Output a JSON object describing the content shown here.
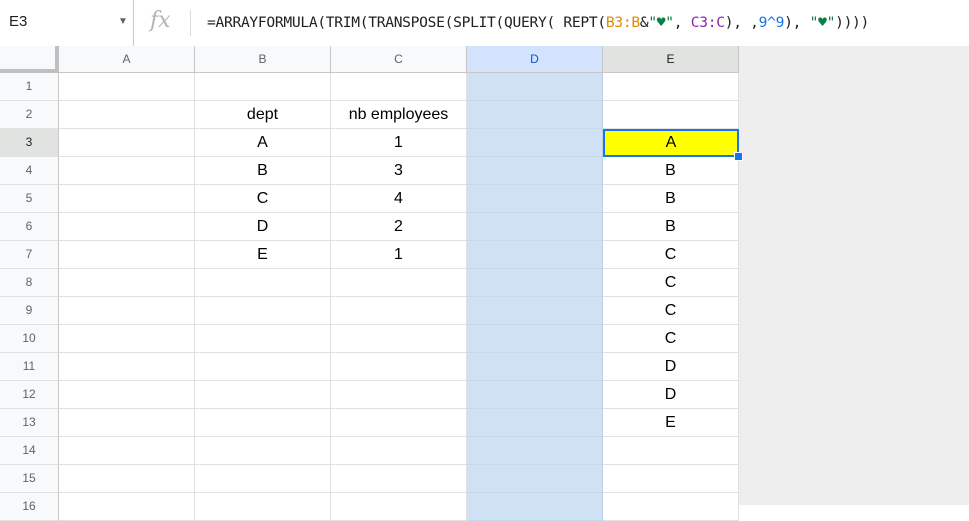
{
  "name_box": "E3",
  "formula": [
    {
      "text": "=ARRAYFORMULA(TRIM(TRANSPOSE(SPLIT(QUERY( REPT(",
      "kind": "plain"
    },
    {
      "text": "B3:B",
      "kind": "ref1"
    },
    {
      "text": "&",
      "kind": "plain"
    },
    {
      "text": "\"♥\"",
      "kind": "str"
    },
    {
      "text": ", ",
      "kind": "plain"
    },
    {
      "text": "C3:C",
      "kind": "ref2"
    },
    {
      "text": "), ,",
      "kind": "plain"
    },
    {
      "text": "9^9",
      "kind": "num"
    },
    {
      "text": "), ",
      "kind": "plain"
    },
    {
      "text": "\"♥\"",
      "kind": "str"
    },
    {
      "text": "))))",
      "kind": "plain"
    }
  ],
  "columns": [
    "A",
    "B",
    "C",
    "D",
    "E"
  ],
  "rows": [
    "1",
    "2",
    "3",
    "4",
    "5",
    "6",
    "7",
    "8",
    "9",
    "10",
    "11",
    "12",
    "13",
    "14",
    "15",
    "16"
  ],
  "cells": {
    "B2": "dept",
    "C2": "nb employees",
    "B3": "A",
    "C3": "1",
    "B4": "B",
    "C4": "3",
    "B5": "C",
    "C5": "4",
    "B6": "D",
    "C6": "2",
    "B7": "E",
    "C7": "1",
    "E3": "A",
    "E4": "B",
    "E5": "B",
    "E6": "B",
    "E7": "C",
    "E8": "C",
    "E9": "C",
    "E10": "C",
    "E11": "D",
    "E12": "D",
    "E13": "E"
  },
  "selected_column": "D",
  "active_cell": "E3",
  "colors": {
    "active_fill": "#ffff00",
    "selection_border": "#1a73e8",
    "column_selection": "#cfe1f3"
  }
}
